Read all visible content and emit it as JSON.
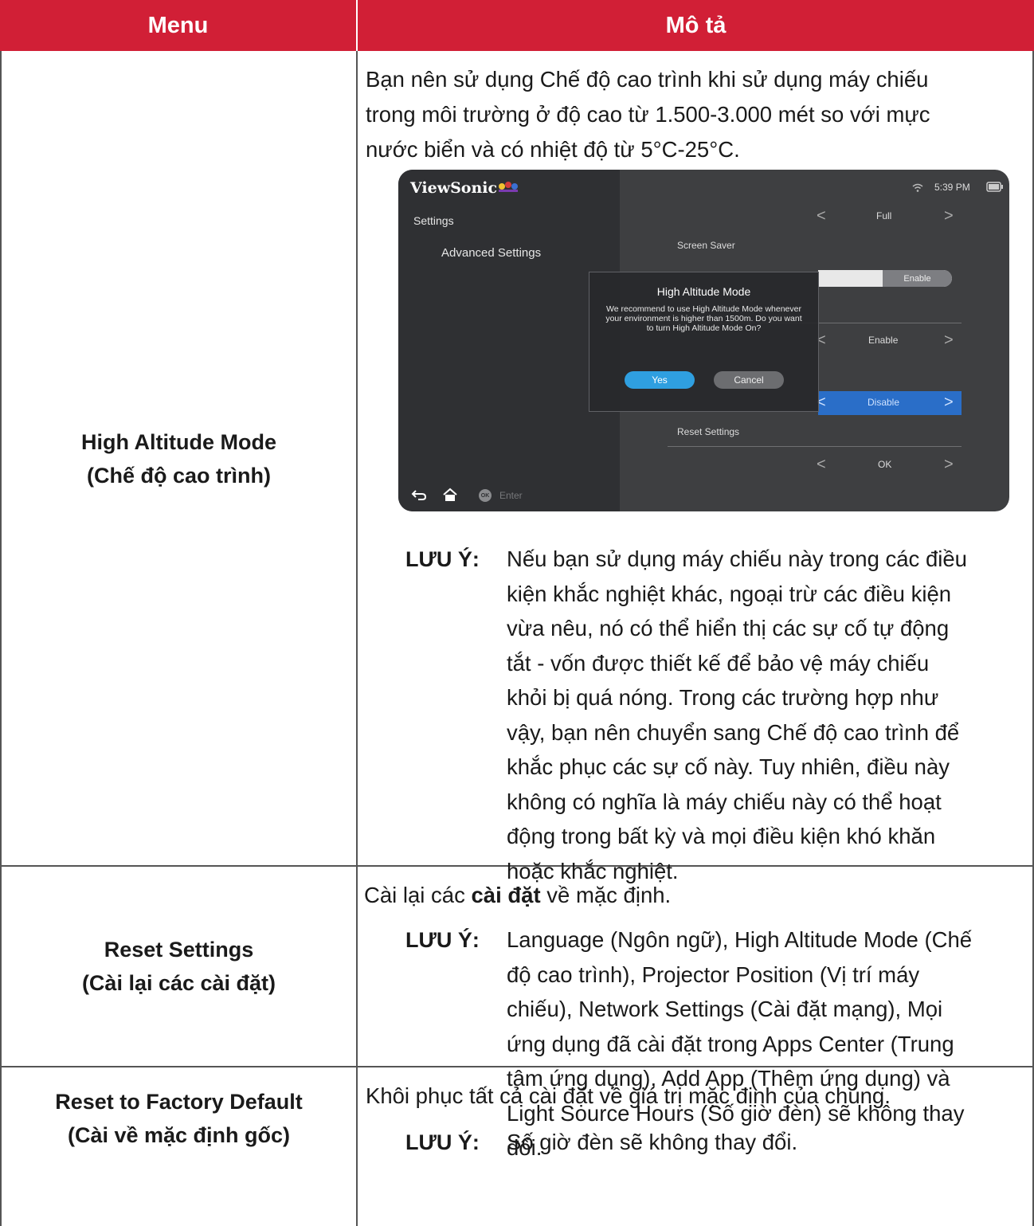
{
  "header": {
    "menu": "Menu",
    "description": "Mô tả"
  },
  "rows": [
    {
      "menu_line1": "High Altitude Mode",
      "menu_line2": "(Chế độ cao trình)",
      "description_lines": [
        "Bạn nên sử dụng Chế độ cao trình khi sử dụng máy chiếu",
        "trong môi trường ở độ cao từ 1.500-3.000 mét so với mực",
        "nước biển và có nhiệt độ từ 5°C-25°C."
      ],
      "note_label": "LƯU Ý:",
      "note_lines": [
        "Nếu bạn sử dụng máy chiếu này trong các điều",
        "kiện khắc nghiệt khác, ngoại trừ các điều kiện",
        "vừa nêu, nó có thể hiển thị các sự cố tự động",
        "tắt - vốn được thiết kế để bảo vệ máy chiếu",
        "khỏi bị quá nóng. Trong các trường hợp như",
        "vậy, bạn nên chuyển sang Chế độ cao trình để",
        "khắc phục các sự cố này. Tuy nhiên, điều này",
        "không có nghĩa là máy chiếu này có thể hoạt",
        "động trong bất kỳ và mọi điều kiện khó khăn",
        "hoặc khắc nghiệt."
      ]
    },
    {
      "menu_line1": "Reset Settings",
      "menu_line2": "(Cài lại các cài đặt)",
      "description_pre": "Cài lại các ",
      "description_bold": "cài đặt",
      "description_post": " về mặc định.",
      "note_label": "LƯU Ý:",
      "note_lines": [
        "Language (Ngôn ngữ), High Altitude Mode (Chế",
        "độ cao trình), Projector Position (Vị trí máy",
        "chiếu), Network Settings (Cài đặt mạng), Mọi",
        "ứng dụng đã cài đặt trong Apps Center (Trung",
        "tâm ứng dụng), Add App (Thêm ứng dụng) và",
        "Light Source Hours (Số giờ đèn) sẽ không thay",
        "đổi."
      ]
    },
    {
      "menu_line1": "Reset to Factory Default",
      "menu_line2": "(Cài về mặc định gốc)",
      "description": "Khôi phục tất cả cài đặt về giá trị mặc định của chúng.",
      "note_label": "LƯU Ý:",
      "note_text": "Số giờ đèn sẽ không thay đổi."
    }
  ],
  "projector_ui": {
    "brand": "ViewSonic",
    "status_time": "5:39 PM",
    "breadcrumb": "Settings",
    "section": "Advanced Settings",
    "row1_value": "Full",
    "screen_saver_label": "Screen Saver",
    "toggle_value": "Enable",
    "row3_value": "Enable",
    "high_altitude_value": "Disable",
    "reset_settings_label": "Reset Settings",
    "reset_value": "OK",
    "enter_hint": "Enter",
    "ok_badge": "OK",
    "dialog": {
      "title": "High Altitude Mode",
      "message": "We recommend to use High Altitude Mode whenever your environment is higher than 1500m. Do you want to turn High Altitude Mode On?",
      "yes": "Yes",
      "cancel": "Cancel"
    },
    "colors": {
      "accent": "#2f9fe0",
      "highlight": "#2a6ec8",
      "panel": "#3e3f41"
    }
  },
  "colors": {
    "header_bg": "#d11f36",
    "header_text": "#ffffff",
    "border": "#555555"
  }
}
